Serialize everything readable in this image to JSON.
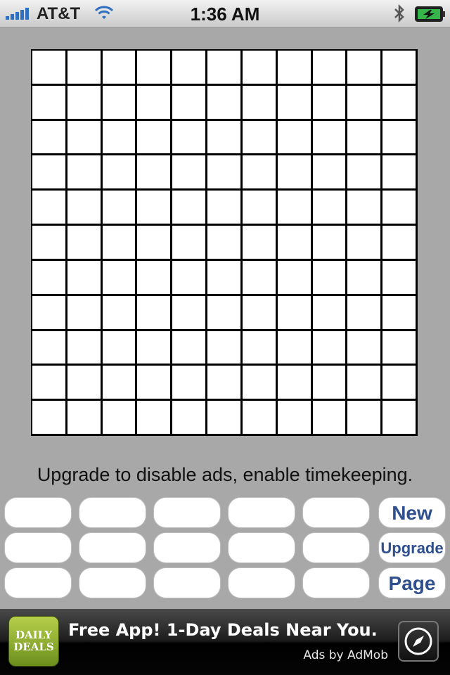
{
  "status_bar": {
    "carrier": "AT&T",
    "time": "1:36 AM",
    "signal_bars": 5,
    "icons": [
      "signal-icon",
      "wifi-icon",
      "bluetooth-icon",
      "battery-charging-icon"
    ]
  },
  "board": {
    "rows": 11,
    "cols": 11
  },
  "message": "Upgrade to disable ads, enable timekeeping.",
  "keypad": {
    "blank_keys": 15,
    "actions": {
      "new": "New",
      "upgrade": "Upgrade",
      "page": "Page"
    }
  },
  "ad": {
    "logo_line1": "DAILY",
    "logo_line2": "DEALS",
    "headline": "Free App! 1-Day Deals Near You.",
    "credit": "Ads by AdMob",
    "icon": "compass-icon"
  },
  "colors": {
    "background": "#a8a8a8",
    "button_text": "#2f4f8f",
    "ad_logo": "#8fb12f",
    "signal": "#2f6fc2",
    "battery": "#35b54a"
  }
}
